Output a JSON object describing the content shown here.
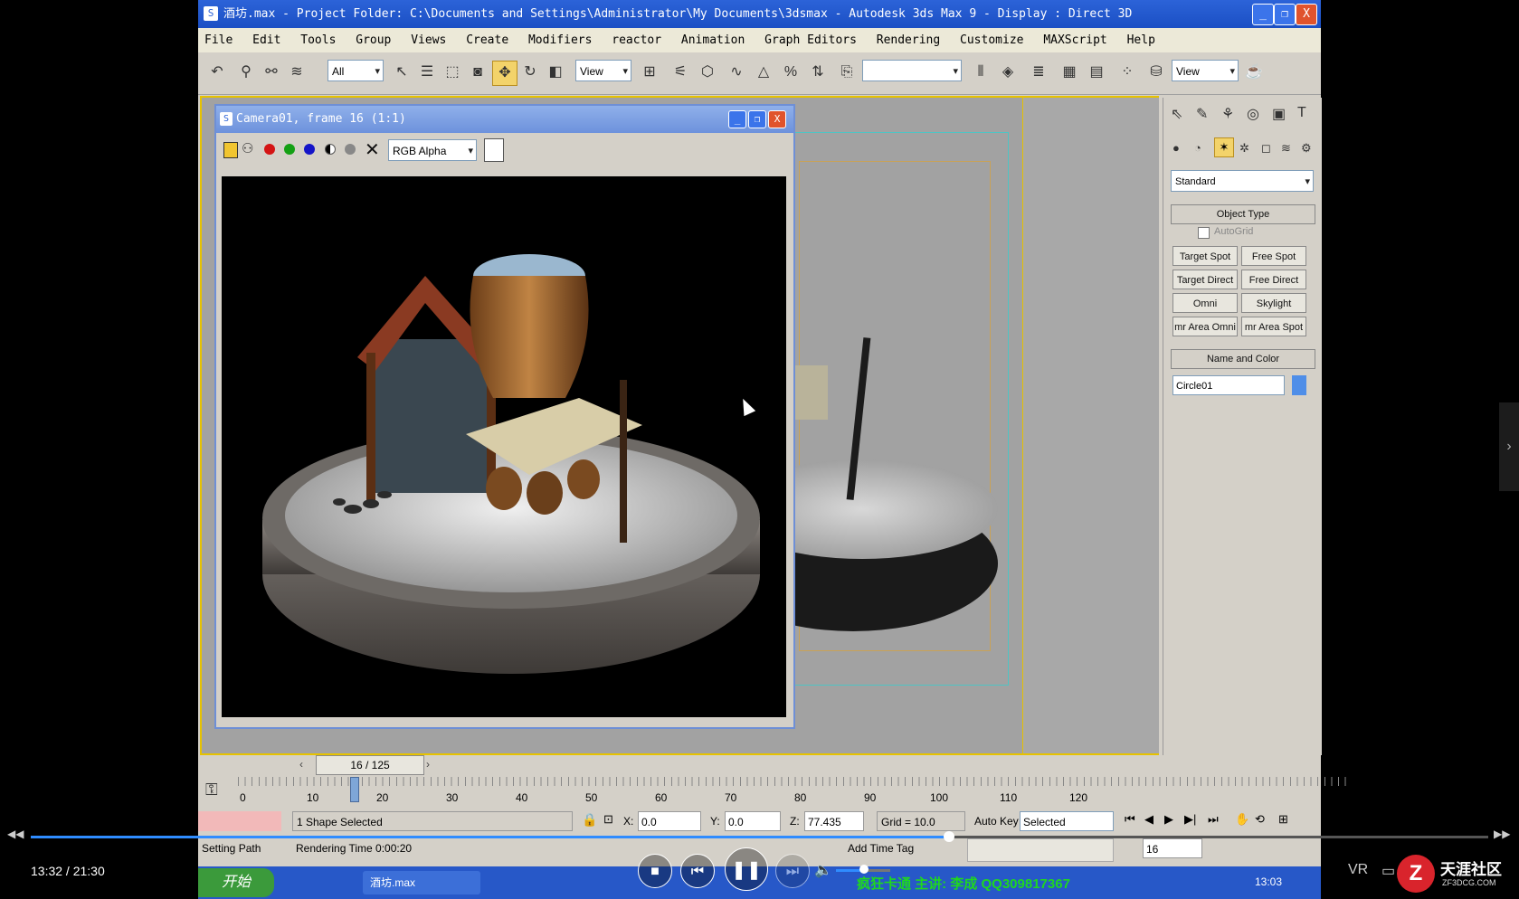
{
  "app": {
    "title": "酒坊.max    - Project Folder: C:\\Documents and Settings\\Administrator\\My Documents\\3dsmax    - Autodesk 3ds Max 9    - Display : Direct 3D",
    "window_controls": [
      "_",
      "❐",
      "X"
    ]
  },
  "menu": [
    "File",
    "Edit",
    "Tools",
    "Group",
    "Views",
    "Create",
    "Modifiers",
    "reactor",
    "Animation",
    "Graph Editors",
    "Rendering",
    "Customize",
    "MAXScript",
    "Help"
  ],
  "toolbar": {
    "selection_filter": "All",
    "reference_coord": "View",
    "named_selection": "",
    "viewport_label": "View"
  },
  "render_window": {
    "title": "Camera01, frame 16 (1:1)",
    "channel": "RGB Alpha",
    "controls": [
      "_",
      "❐",
      "X"
    ]
  },
  "command_panel": {
    "category": "Standard",
    "object_type_header": "Object Type",
    "autogrid_label": "AutoGrid",
    "buttons": [
      "Target Spot",
      "Free Spot",
      "Target Direct",
      "Free Direct",
      "Omni",
      "Skylight",
      "mr Area Omni",
      "mr Area Spot"
    ],
    "name_color_header": "Name and Color",
    "object_name": "Circle01",
    "object_color": "#4f8ee8"
  },
  "timeline": {
    "frame_counter": "16 / 125",
    "ticks": [
      "0",
      "10",
      "20",
      "30",
      "40",
      "50",
      "60",
      "70",
      "80",
      "90",
      "100",
      "110",
      "120"
    ]
  },
  "status": {
    "selection": "1 Shape Selected",
    "x_label": "X:",
    "x_value": "0.0",
    "y_label": "Y:",
    "y_value": "0.0",
    "z_label": "Z:",
    "z_value": "77.435",
    "grid": "Grid = 10.0",
    "auto_key": "Auto Key",
    "key_mode": "Selected",
    "setting_path": "Setting Path",
    "rendering_time": "Rendering Time 0:00:20",
    "add_time_tag": "Add Time Tag",
    "current_frame": "16"
  },
  "taskbar": {
    "start": "开始",
    "task_item": "酒坊.max",
    "ticker": "疯狂卡通  主讲: 李成 QQ309817367",
    "clock": "13:03"
  },
  "player": {
    "time": "13:32 / 21:30",
    "vr": "VR",
    "watermark_line1": "天涯社区",
    "watermark_line2": "ZF3DCG.COM",
    "progress": 0.63
  }
}
